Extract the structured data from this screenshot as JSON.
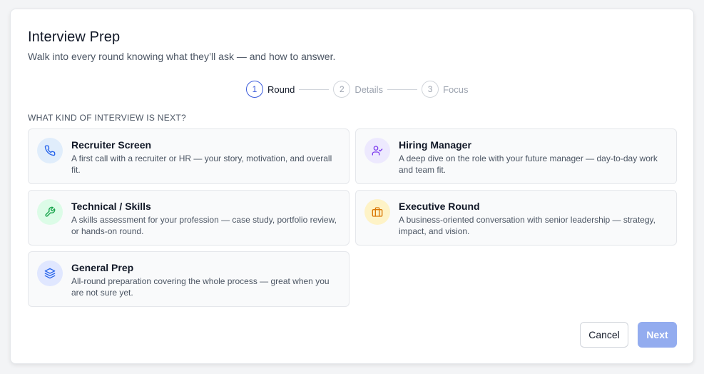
{
  "header": {
    "title": "Interview Prep",
    "subtitle": "Walk into every round knowing what they’ll ask — and how to answer."
  },
  "stepper": {
    "steps": [
      {
        "number": "1",
        "label": "Round",
        "active": true
      },
      {
        "number": "2",
        "label": "Details",
        "active": false
      },
      {
        "number": "3",
        "label": "Focus",
        "active": false
      }
    ]
  },
  "section": {
    "label": "WHAT KIND OF INTERVIEW IS NEXT?"
  },
  "options": [
    {
      "title": "Recruiter Screen",
      "description": "A first call with a recruiter or HR — your story, motivation, and overall fit.",
      "icon": "phone-icon",
      "color": "#2563eb",
      "bg": "#e0edfb"
    },
    {
      "title": "Hiring Manager",
      "description": "A deep dive on the role with your future manager — day-to-day work and team fit.",
      "icon": "user-check-icon",
      "color": "#7c3aed",
      "bg": "#ede9fe"
    },
    {
      "title": "Technical / Skills",
      "description": "A skills assessment for your profession — case study, portfolio review, or hands-on round.",
      "icon": "wrench-icon",
      "color": "#16a34a",
      "bg": "#dcfce7"
    },
    {
      "title": "Executive Round",
      "description": "A business-oriented conversation with senior leadership — strategy, impact, and vision.",
      "icon": "briefcase-icon",
      "color": "#d97706",
      "bg": "#fef3c7"
    },
    {
      "title": "General Prep",
      "description": "All-round preparation covering the whole process — great when you are not sure yet.",
      "icon": "layers-icon",
      "color": "#2563eb",
      "bg": "#e0e7ff"
    }
  ],
  "footer": {
    "cancel_label": "Cancel",
    "next_label": "Next"
  }
}
